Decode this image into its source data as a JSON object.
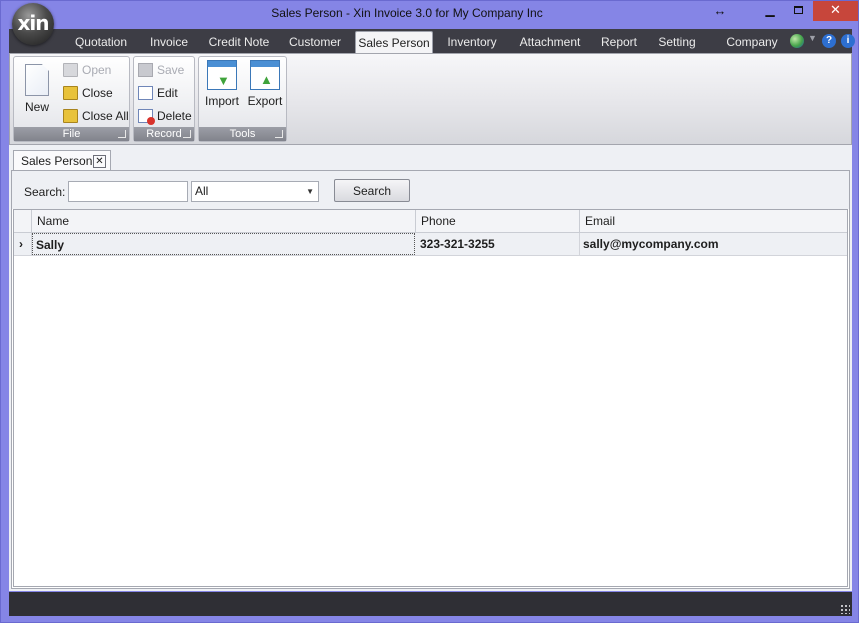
{
  "window": {
    "title": "Sales Person - Xin Invoice 3.0 for My Company Inc",
    "logo_text": "xin",
    "minimize_label": "▁",
    "close_label": "✕",
    "resize_label": "↔"
  },
  "ribbon_tabs": [
    {
      "label": "Quotation"
    },
    {
      "label": "Invoice"
    },
    {
      "label": "Credit Note"
    },
    {
      "label": "Customer"
    },
    {
      "label": "Sales Person"
    },
    {
      "label": "Inventory"
    },
    {
      "label": "Attachment"
    },
    {
      "label": "Report"
    },
    {
      "label": "Setting"
    }
  ],
  "active_tab": "Sales Person",
  "ribbon_right": {
    "company_label": "Company",
    "help_label": "?",
    "info_label": "i"
  },
  "ribbon": {
    "file_group": {
      "label": "File",
      "new_label": "New",
      "open_label": "Open",
      "close_label": "Close",
      "close_all_label": "Close All"
    },
    "record_group": {
      "label": "Record",
      "save_label": "Save",
      "edit_label": "Edit",
      "delete_label": "Delete"
    },
    "tools_group": {
      "label": "Tools",
      "import_label": "Import",
      "export_label": "Export"
    }
  },
  "document_tab": {
    "label": "Sales Person",
    "close_label": "✕"
  },
  "search": {
    "label": "Search:",
    "input_value": "",
    "scope_value": "All",
    "button_label": "Search"
  },
  "grid": {
    "columns": [
      "Name",
      "Phone",
      "Email"
    ],
    "rows": [
      {
        "indicator": "›",
        "name": "Sally",
        "phone": "323-321-3255",
        "email": "sally@mycompany.com"
      }
    ]
  }
}
